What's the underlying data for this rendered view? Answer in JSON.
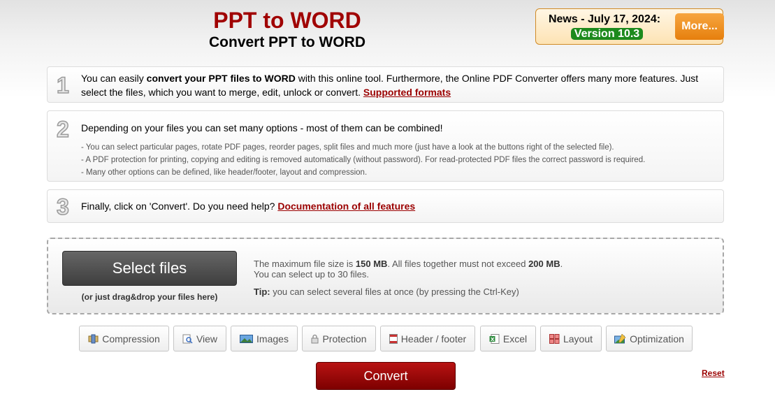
{
  "header": {
    "title": "PPT to WORD",
    "subtitle": "Convert PPT to WORD"
  },
  "news": {
    "date_label": "News - July 17, 2024:",
    "version_label": "Version 10.3",
    "more_label": "More..."
  },
  "steps": [
    {
      "number": "1",
      "text_before": "You can easily ",
      "text_bold": "convert your PPT files to WORD",
      "text_after": " with this online tool. Furthermore, the Online PDF Converter offers many more features. Just select the files, which you want to merge, edit, unlock or convert. ",
      "link": "Supported formats"
    },
    {
      "number": "2",
      "text": "Depending on your files you can set many options - most of them can be combined!",
      "bullets": [
        "- You can select particular pages, rotate PDF pages, reorder pages, split files and much more (just have a look at the buttons right of the selected file).",
        "- A PDF protection for printing, copying and editing is removed automatically (without password). For read-protected PDF files the correct password is required.",
        "- Many other options can be defined, like header/footer, layout and compression."
      ]
    },
    {
      "number": "3",
      "text": "Finally, click on 'Convert'. Do you need help? ",
      "link": "Documentation of all features"
    }
  ],
  "upload": {
    "select_label": "Select files",
    "drag_hint": "(or just drag&drop your files here)",
    "limit_prefix": "The maximum file size is ",
    "limit_size": "150 MB",
    "limit_mid": ". All files together must not exceed ",
    "limit_total": "200 MB",
    "limit_suffix": ".",
    "limit_count": "You can select up to 30 files.",
    "tip_label": "Tip:",
    "tip_text": " you can select several files at once (by pressing the Ctrl-Key)"
  },
  "options": [
    {
      "label": "Compression",
      "icon": "compression-icon"
    },
    {
      "label": "View",
      "icon": "view-icon"
    },
    {
      "label": "Images",
      "icon": "images-icon"
    },
    {
      "label": "Protection",
      "icon": "protection-icon"
    },
    {
      "label": "Header / footer",
      "icon": "header-footer-icon"
    },
    {
      "label": "Excel",
      "icon": "excel-icon"
    },
    {
      "label": "Layout",
      "icon": "layout-icon"
    },
    {
      "label": "Optimization",
      "icon": "optimization-icon"
    }
  ],
  "actions": {
    "convert_label": "Convert",
    "reset_label": "Reset"
  },
  "colors": {
    "brand_red": "#a00000",
    "link_red": "#9b0000",
    "version_green": "#1d8a1d",
    "more_orange": "#e67f0d"
  }
}
